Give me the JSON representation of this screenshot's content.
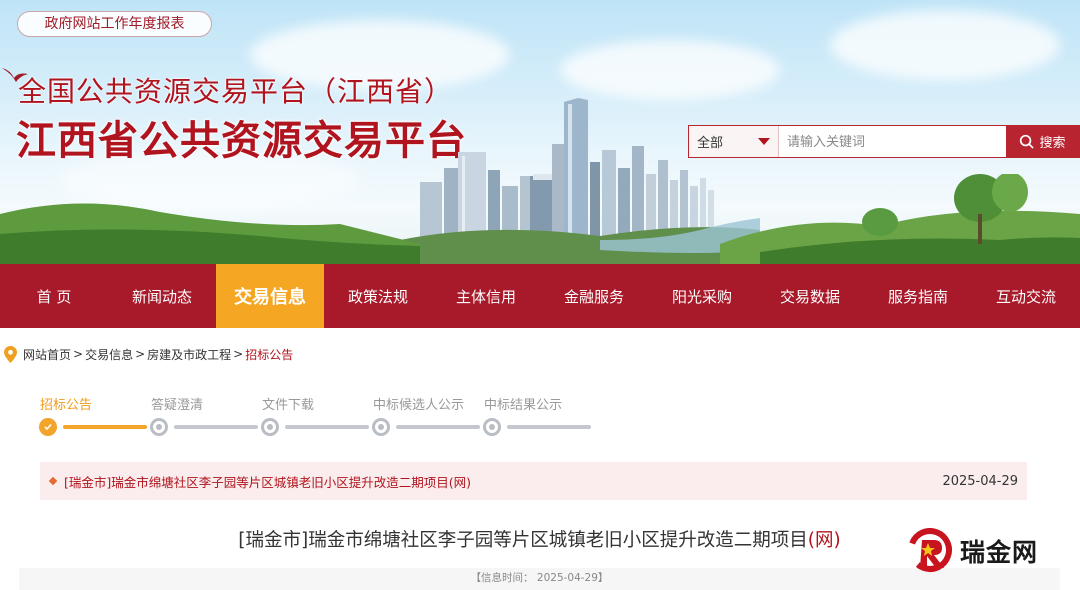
{
  "banner": {
    "report_link": "政府网站工作年度报表",
    "title_top": "全国公共资源交易平台（江西省）",
    "title_main": "江西省公共资源交易平台"
  },
  "search": {
    "select_value": "全部",
    "placeholder": "请输入关键词",
    "button_label": "搜索"
  },
  "nav": {
    "items": [
      {
        "label": "首 页"
      },
      {
        "label": "新闻动态"
      },
      {
        "label": "交易信息"
      },
      {
        "label": "政策法规"
      },
      {
        "label": "主体信用"
      },
      {
        "label": "金融服务"
      },
      {
        "label": "阳光采购"
      },
      {
        "label": "交易数据"
      },
      {
        "label": "服务指南"
      },
      {
        "label": "互动交流"
      }
    ],
    "active_index": 2
  },
  "breadcrumb": {
    "items": [
      "网站首页",
      "交易信息",
      "房建及市政工程"
    ],
    "current": "招标公告"
  },
  "steps": [
    {
      "label": "招标公告"
    },
    {
      "label": "答疑澄清"
    },
    {
      "label": "文件下载"
    },
    {
      "label": "中标候选人公示"
    },
    {
      "label": "中标结果公示"
    }
  ],
  "notice": {
    "title": "[瑞金市]瑞金市绵塘社区李子园等片区城镇老旧小区提升改造二期项目(网)",
    "date": "2025-04-29"
  },
  "article": {
    "title_main": "[瑞金市]瑞金市绵塘社区李子园等片区城镇老旧小区提升改造二期项目",
    "title_suffix": "(网)",
    "info": "【信息时间： 2025-04-29】"
  },
  "watermark": {
    "text": "瑞金网"
  },
  "colors": {
    "brand_red": "#a8192a",
    "accent_orange": "#f5a623",
    "title_red": "#b0141e"
  }
}
